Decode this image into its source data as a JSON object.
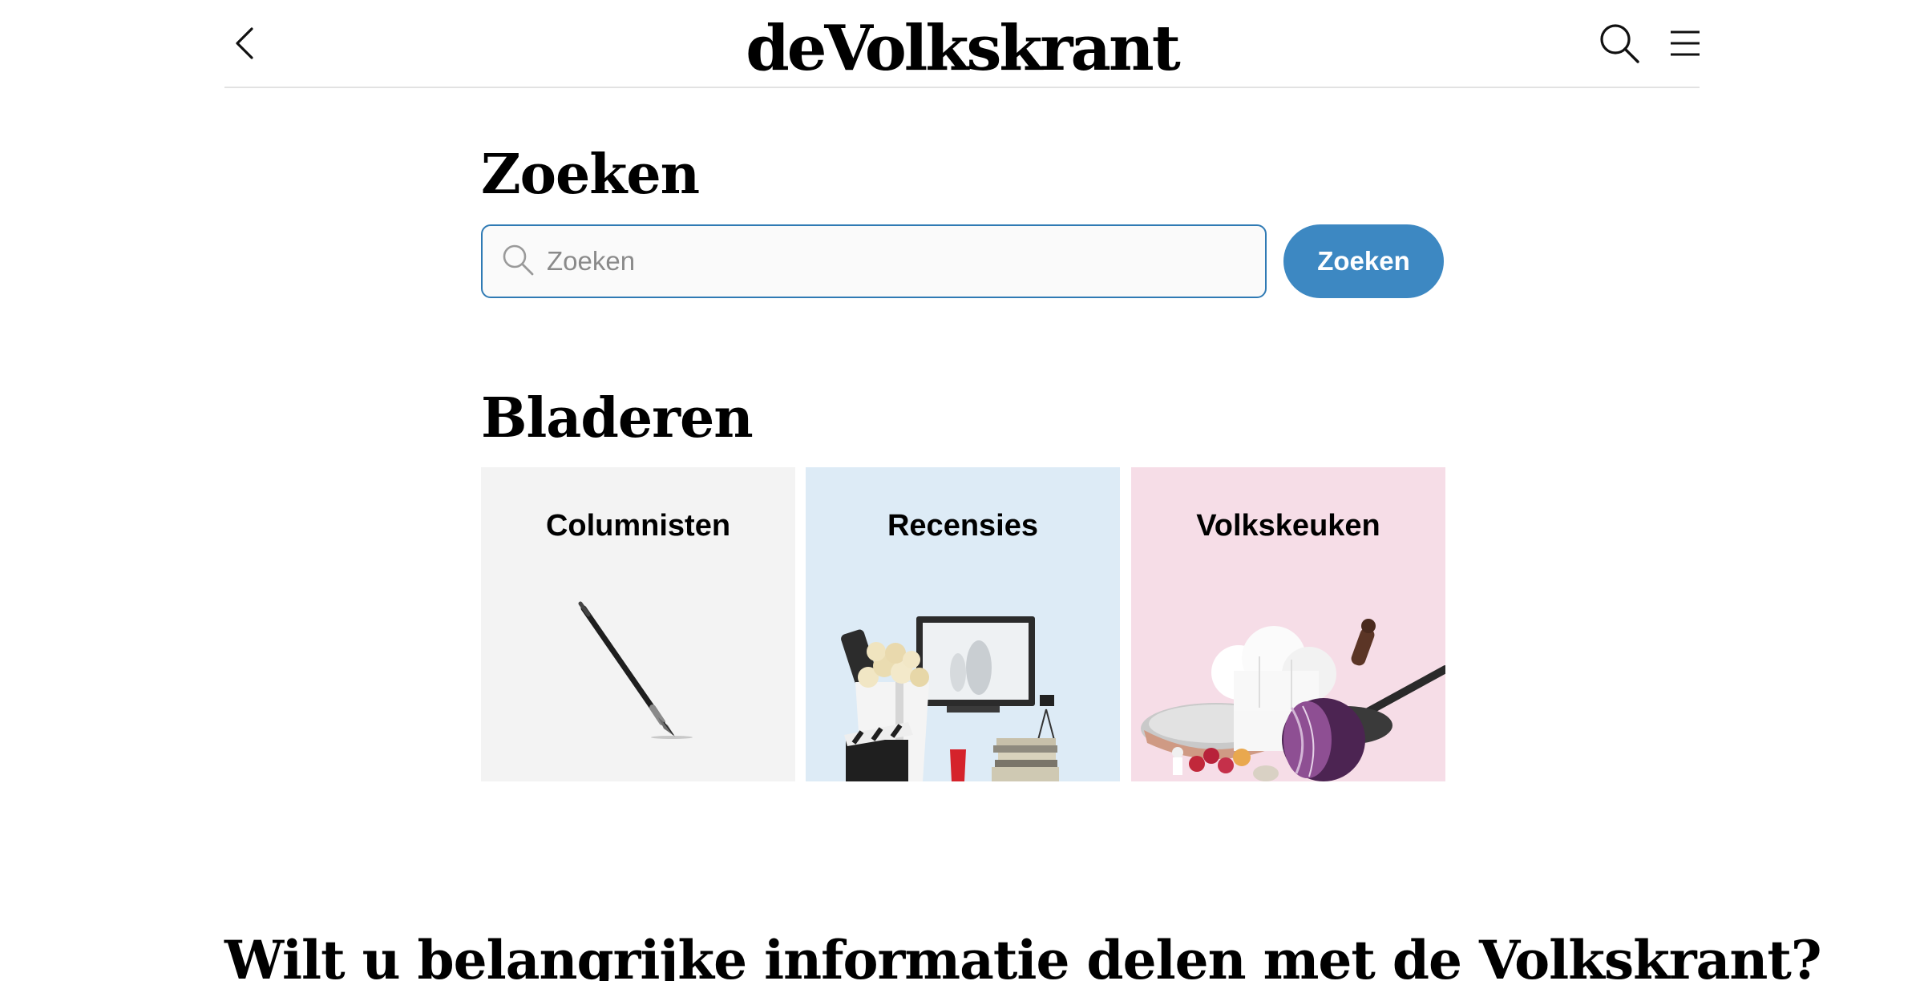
{
  "header": {
    "logo_text": "deVolkskrant",
    "back_icon": "chevron-left-icon",
    "search_icon": "search-icon",
    "menu_icon": "hamburger-menu-icon"
  },
  "search": {
    "heading": "Zoeken",
    "placeholder": "Zoeken",
    "value": "",
    "button_label": "Zoeken",
    "accent_color": "#3d88c2"
  },
  "browse": {
    "heading": "Bladeren",
    "tiles": [
      {
        "label": "Columnisten",
        "background": "#f3f3f3",
        "image": "fountain-pen-illustration"
      },
      {
        "label": "Recensies",
        "background": "#ddebf6",
        "image": "popcorn-tv-books-illustration"
      },
      {
        "label": "Volkskeuken",
        "background": "#f6dde7",
        "image": "chef-hat-pan-cabbage-illustration"
      }
    ]
  },
  "footer": {
    "heading": "Wilt u belangrijke informatie delen met de Volkskrant?"
  }
}
